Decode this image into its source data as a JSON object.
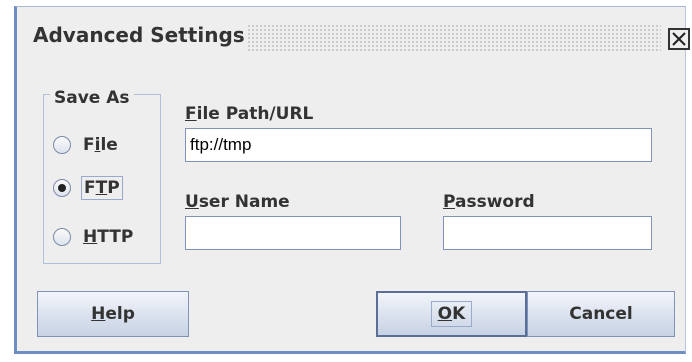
{
  "window": {
    "title": "Advanced Settings",
    "close_icon": "close-icon"
  },
  "save_as": {
    "legend": "Save As",
    "options": [
      {
        "label": "File",
        "mnemonic": "i",
        "selected": false
      },
      {
        "label": "FTP",
        "mnemonic": "T",
        "selected": true
      },
      {
        "label": "HTTP",
        "mnemonic": "H",
        "selected": false
      }
    ]
  },
  "file_path": {
    "label": "File Path/URL",
    "value": "ftp://tmp"
  },
  "user_name": {
    "label": "User Name",
    "value": ""
  },
  "password": {
    "label": "Password",
    "value": ""
  },
  "buttons": {
    "help": "Help",
    "ok": "OK",
    "cancel": "Cancel"
  },
  "colors": {
    "frame_border": "#6d8ec5",
    "background": "#eeeeee",
    "button_gradient_end": "#c7d2e4"
  }
}
